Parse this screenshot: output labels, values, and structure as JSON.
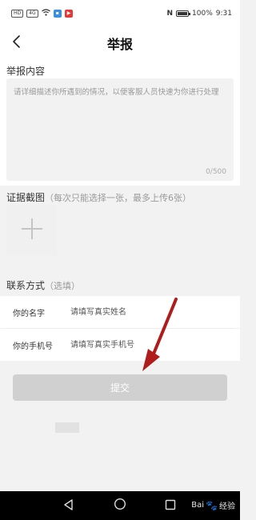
{
  "status_bar": {
    "left_icons": [
      "HD",
      "4G",
      "wifi-icon",
      "app-notify-icon",
      "video-app-icon"
    ],
    "nfc": "N",
    "battery": "100%",
    "time": "9:31"
  },
  "header": {
    "title": "举报"
  },
  "report": {
    "label": "举报内容",
    "placeholder": "请详细描述你所遇到的情况，以便客服人员快速为你进行处理",
    "counter": "0/500"
  },
  "screenshot": {
    "label": "证据截图",
    "hint": "（每次只能选择一张，最多上传6张）"
  },
  "contact": {
    "label": "联系方式",
    "hint": "（选填）",
    "name_label": "你的名字",
    "name_placeholder": "请填写真实姓名",
    "phone_label": "你的手机号",
    "phone_placeholder": "请填写真实手机号"
  },
  "submit_label": "提交",
  "watermark": {
    "text_a": "Bai",
    "text_b": "经验"
  },
  "colors": {
    "arrow": "#b01c1c",
    "submit_bg": "#d0d0d0"
  }
}
